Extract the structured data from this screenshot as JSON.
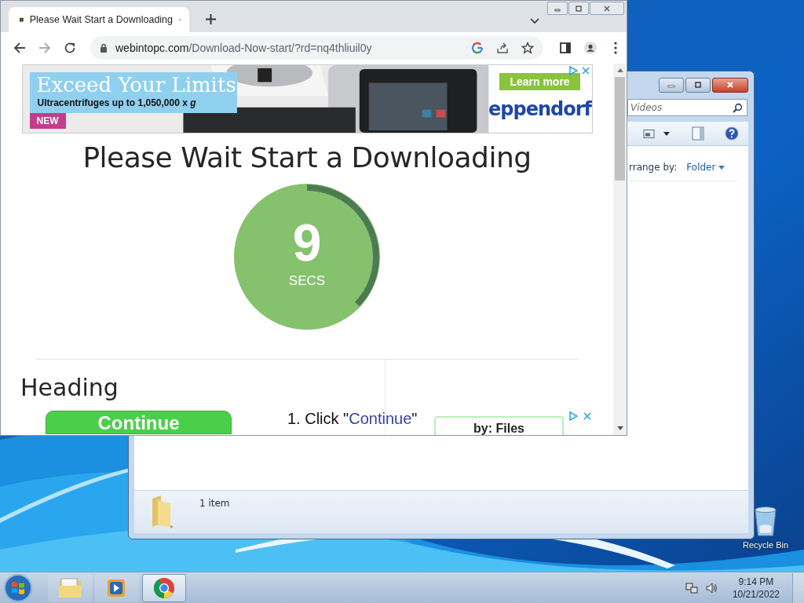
{
  "desktop": {
    "icons": [
      {
        "label": "Recycle Bin"
      }
    ]
  },
  "explorer": {
    "search": {
      "placeholder": "Videos"
    },
    "arrange_label": "rrange by:",
    "arrange_value": "Folder",
    "status": "1 item"
  },
  "browser": {
    "tab": {
      "title": "Please Wait Start a Downloading",
      "selected": true
    },
    "address": {
      "domain": "webintopc.com",
      "path": "/Download-Now-start/?rd=nq4thliuil0y"
    },
    "ad": {
      "headline": "Exceed Your Limits",
      "subline": "Ultracentrifuges up to 1,050,000 x *g*",
      "badge": "NEW",
      "cta": "Learn more",
      "brand": "eppendorf"
    },
    "page": {
      "title": "Please Wait Start a Downloading",
      "countdown": {
        "value": "9",
        "unit": "SECS",
        "level": 0.37
      },
      "heading": "Heading",
      "button": "Continue",
      "steps": [
        {
          "prefix": "1. Click \"",
          "link": "Continue",
          "suffix": "\""
        }
      ],
      "ad2": {
        "text": "by: Files"
      }
    }
  },
  "taskbar": {
    "apps": [
      {
        "kind": "explorer",
        "selected": false
      },
      {
        "kind": "media",
        "selected": false
      },
      {
        "kind": "chrome",
        "selected": true
      }
    ],
    "clock": {
      "time": "9:14 PM",
      "date": "10/21/2022"
    }
  }
}
